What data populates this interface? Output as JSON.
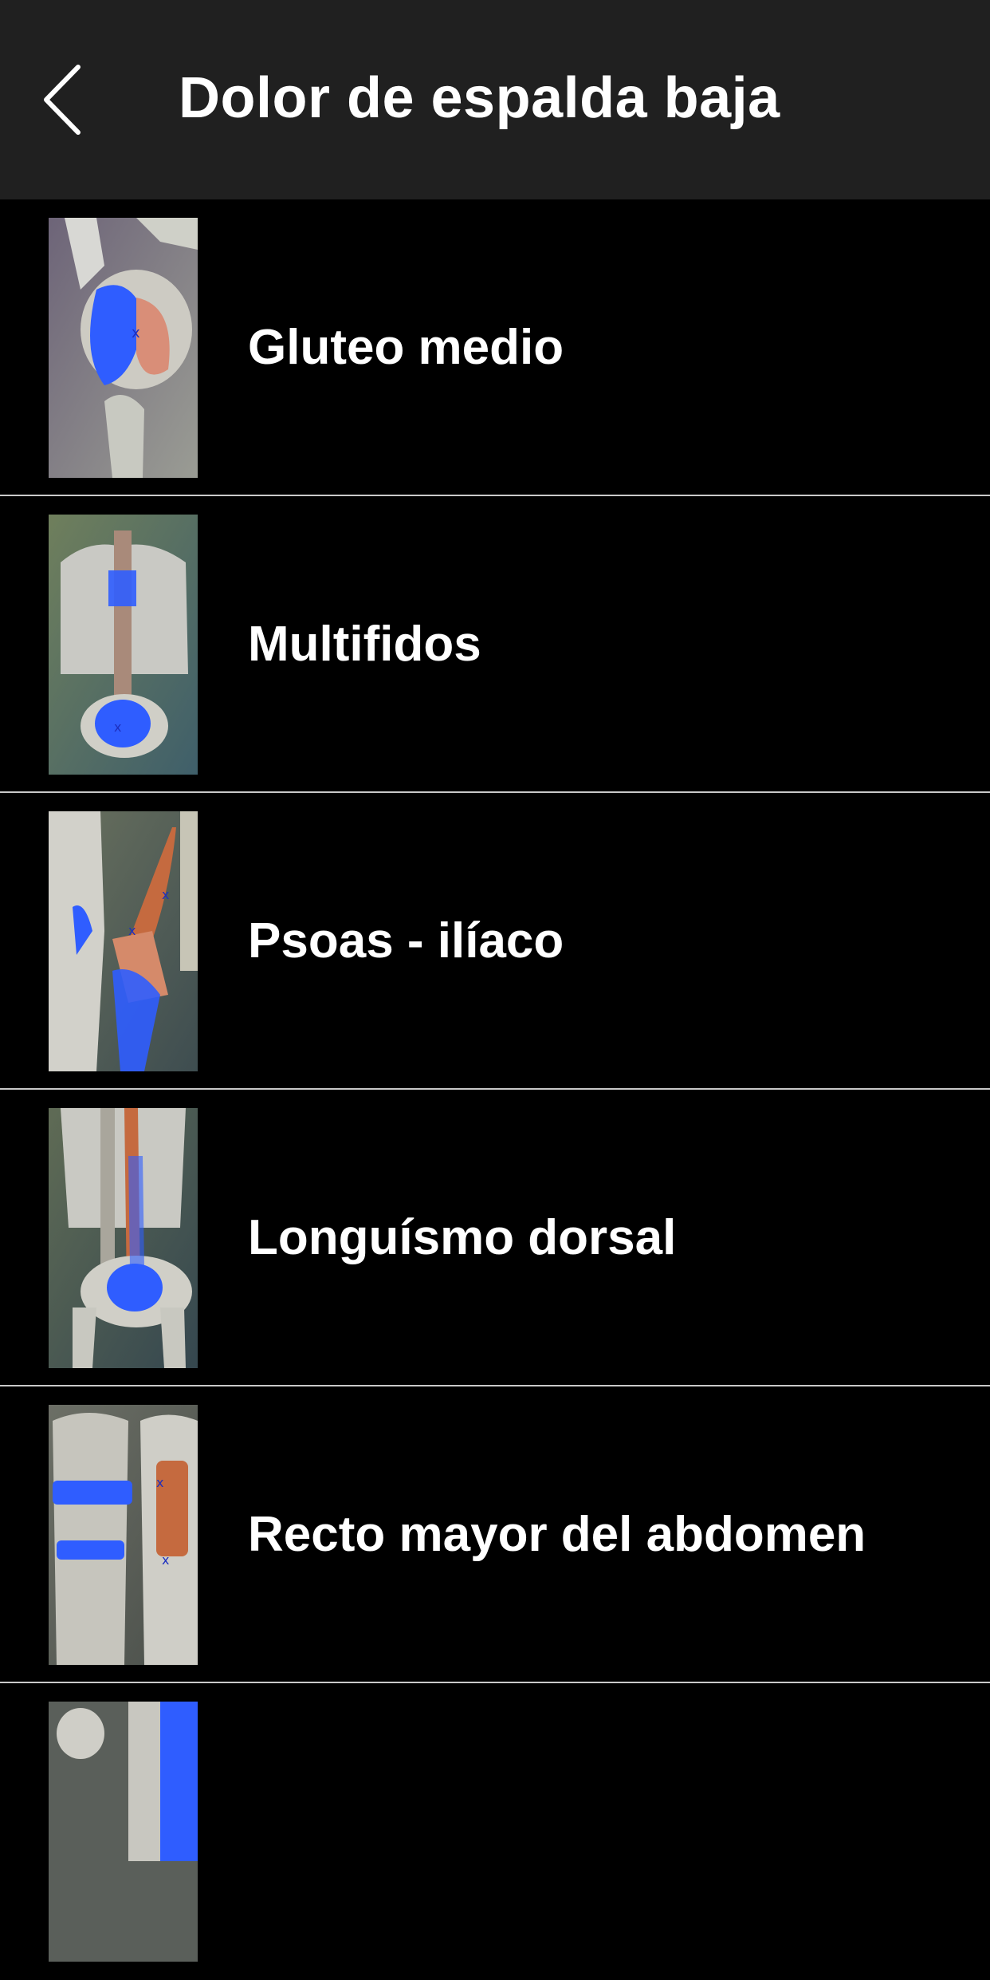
{
  "header": {
    "title": "Dolor de espalda baja",
    "back_icon": "chevron-left-icon"
  },
  "colors": {
    "header_bg": "#202020",
    "list_bg": "#000000",
    "divider": "#c9c9c9",
    "text": "#ffffff",
    "pain_highlight": "#2f5dff",
    "muscle": "#c56a3f"
  },
  "items": [
    {
      "label": "Gluteo medio"
    },
    {
      "label": "Multifidos"
    },
    {
      "label": "Psoas - ilíaco"
    },
    {
      "label": "Longuísmo dorsal"
    },
    {
      "label": "Recto mayor del abdomen"
    },
    {
      "label": ""
    }
  ]
}
